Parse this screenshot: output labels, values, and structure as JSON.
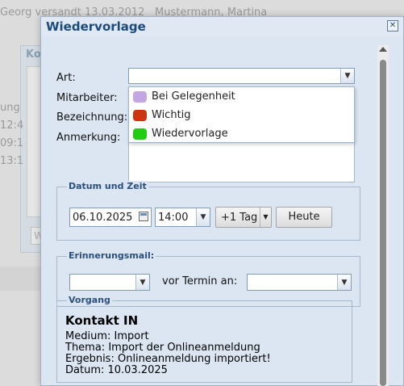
{
  "background": {
    "header_text_left": "Georg versandt 13.03.2012",
    "header_text_right": "Mustermann, Martina",
    "panel_title": "Ko",
    "side_fragments": [
      "ung",
      "12:4",
      "09:1",
      "13:1"
    ],
    "side_button": "W"
  },
  "dialog": {
    "title": "Wiedervorlage",
    "close_icon": "close-icon"
  },
  "form": {
    "art_label": "Art:",
    "art_value": "",
    "mitarbeiter_label": "Mitarbeiter:",
    "bezeichnung_label": "Bezeichnung:",
    "anmerkung_label": "Anmerkung:"
  },
  "art_dropdown": {
    "options": [
      {
        "label": "Bei Gelegenheit",
        "color": "#c4a6e6"
      },
      {
        "label": "Wichtig",
        "color": "#cc3311"
      },
      {
        "label": "Wiedervorlage",
        "color": "#22cc11"
      }
    ]
  },
  "datetime": {
    "legend": "Datum und Zeit",
    "date": "06.10.2025",
    "time": "14:00",
    "plus_day": "+1 Tag",
    "today": "Heute"
  },
  "reminder": {
    "legend": "Erinnerungsmail:",
    "first_select": "",
    "middle_text": "vor Termin an:",
    "second_select": ""
  },
  "vorgang": {
    "legend": "Vorgang",
    "title": "Kontakt IN",
    "medium": "Medium: Import",
    "thema": "Thema: Import der Onlineanmeldung",
    "ergebnis": "Ergebnis: Onlineanmeldung importiert!",
    "datum": "Datum: 10.03.2025"
  },
  "colors": {
    "title": "#1b4a7e",
    "dialog_bg": "#dce6f2",
    "accent_border": "#7f9db9"
  }
}
